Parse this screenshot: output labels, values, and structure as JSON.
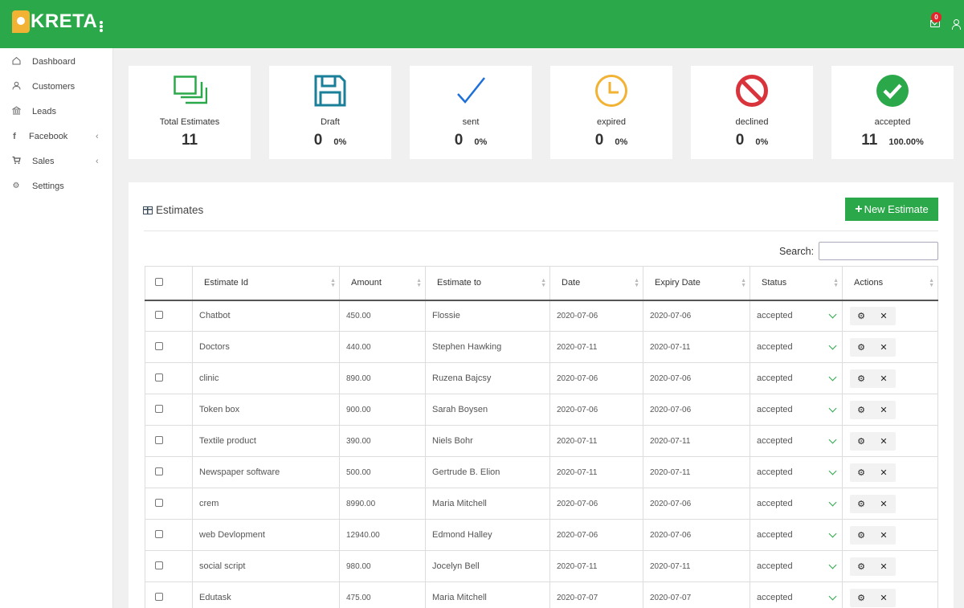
{
  "brand": {
    "name": "KRETA"
  },
  "header": {
    "notification_count": "0"
  },
  "sidebar": {
    "items": [
      {
        "label": "Dashboard",
        "icon": "home-icon"
      },
      {
        "label": "Customers",
        "icon": "user-icon"
      },
      {
        "label": "Leads",
        "icon": "bank-icon"
      },
      {
        "label": "Facebook",
        "icon": "facebook-icon"
      },
      {
        "label": "Sales",
        "icon": "cart-icon"
      },
      {
        "label": "Settings",
        "icon": "gear-icon"
      }
    ]
  },
  "stats": [
    {
      "label": "Total Estimates",
      "value": "11",
      "percent": "",
      "icon": "copy-icon",
      "color": "#2ba84a"
    },
    {
      "label": "Draft",
      "value": "0",
      "percent": "0%",
      "icon": "floppy-icon",
      "color": "#1a7f99"
    },
    {
      "label": "sent",
      "value": "0",
      "percent": "0%",
      "icon": "check-icon",
      "color": "#1e6fd9"
    },
    {
      "label": "expired",
      "value": "0",
      "percent": "0%",
      "icon": "clock-icon",
      "color": "#f2b233"
    },
    {
      "label": "declined",
      "value": "0",
      "percent": "0%",
      "icon": "ban-icon",
      "color": "#d9333c"
    },
    {
      "label": "accepted",
      "value": "11",
      "percent": "100.00%",
      "icon": "check-circle-icon",
      "color": "#2ba84a"
    }
  ],
  "panel": {
    "title": "Estimates",
    "new_button": "New Estimate",
    "search_label": "Search:",
    "columns": [
      "Estimate Id",
      "Amount",
      "Estimate to",
      "Date",
      "Expiry Date",
      "Status",
      "Actions"
    ],
    "rows": [
      {
        "id": "Chatbot",
        "amount": "450.00",
        "to": "Flossie",
        "date": "2020-07-06",
        "expiry": "2020-07-06",
        "status": "accepted"
      },
      {
        "id": "Doctors",
        "amount": "440.00",
        "to": "Stephen Hawking",
        "date": "2020-07-11",
        "expiry": "2020-07-11",
        "status": "accepted"
      },
      {
        "id": "clinic",
        "amount": "890.00",
        "to": "Ruzena Bajcsy",
        "date": "2020-07-06",
        "expiry": "2020-07-06",
        "status": "accepted"
      },
      {
        "id": "Token box",
        "amount": "900.00",
        "to": "Sarah Boysen",
        "date": "2020-07-06",
        "expiry": "2020-07-06",
        "status": "accepted"
      },
      {
        "id": "Textile product",
        "amount": "390.00",
        "to": "Niels Bohr",
        "date": "2020-07-11",
        "expiry": "2020-07-11",
        "status": "accepted"
      },
      {
        "id": "Newspaper software",
        "amount": "500.00",
        "to": "Gertrude B. Elion",
        "date": "2020-07-11",
        "expiry": "2020-07-11",
        "status": "accepted"
      },
      {
        "id": "crem",
        "amount": "8990.00",
        "to": "Maria Mitchell",
        "date": "2020-07-06",
        "expiry": "2020-07-06",
        "status": "accepted"
      },
      {
        "id": "web Devlopment",
        "amount": "12940.00",
        "to": "Edmond Halley",
        "date": "2020-07-06",
        "expiry": "2020-07-06",
        "status": "accepted"
      },
      {
        "id": "social script",
        "amount": "980.00",
        "to": "Jocelyn Bell",
        "date": "2020-07-11",
        "expiry": "2020-07-11",
        "status": "accepted"
      },
      {
        "id": "Edutask",
        "amount": "475.00",
        "to": "Maria Mitchell",
        "date": "2020-07-07",
        "expiry": "2020-07-07",
        "status": "accepted"
      }
    ]
  }
}
